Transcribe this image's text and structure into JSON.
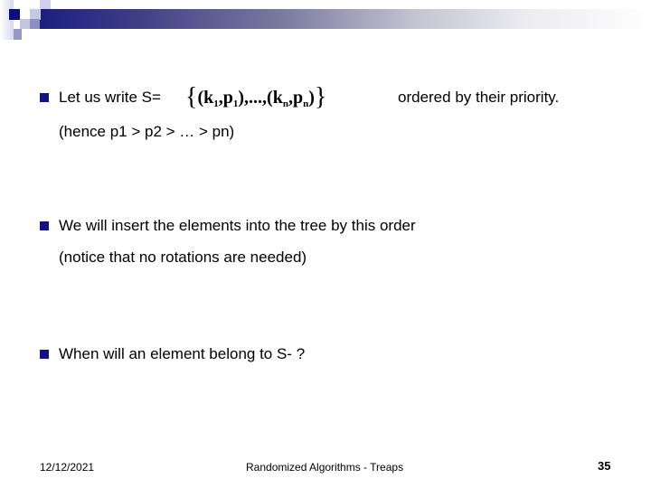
{
  "header": {
    "decor_colors": {
      "bar_start": "#1c1c82",
      "bar_end": "#ffffff",
      "bullet": "#111188"
    }
  },
  "body": {
    "bullet1": {
      "prefix": "Let us write S=",
      "math": {
        "open_brace": "{",
        "close_brace": "}",
        "first_pair": {
          "k": "k",
          "k_sub": "1",
          "p": "p",
          "p_sub": "1"
        },
        "ellipsis": ",...,",
        "last_pair": {
          "k": "k",
          "k_sub": "n",
          "p": "p",
          "p_sub": "n"
        }
      },
      "suffix": "ordered by their priority.",
      "note": "(hence p1 > p2 > … > pn)"
    },
    "bullet2": {
      "text": "We will insert the elements into the tree by this order",
      "note": "(notice that no rotations are needed)"
    },
    "bullet3": {
      "text": "When will an element belong to S- ?"
    }
  },
  "footer": {
    "date": "12/12/2021",
    "title": "Randomized Algorithms - Treaps",
    "page_number": "35"
  }
}
